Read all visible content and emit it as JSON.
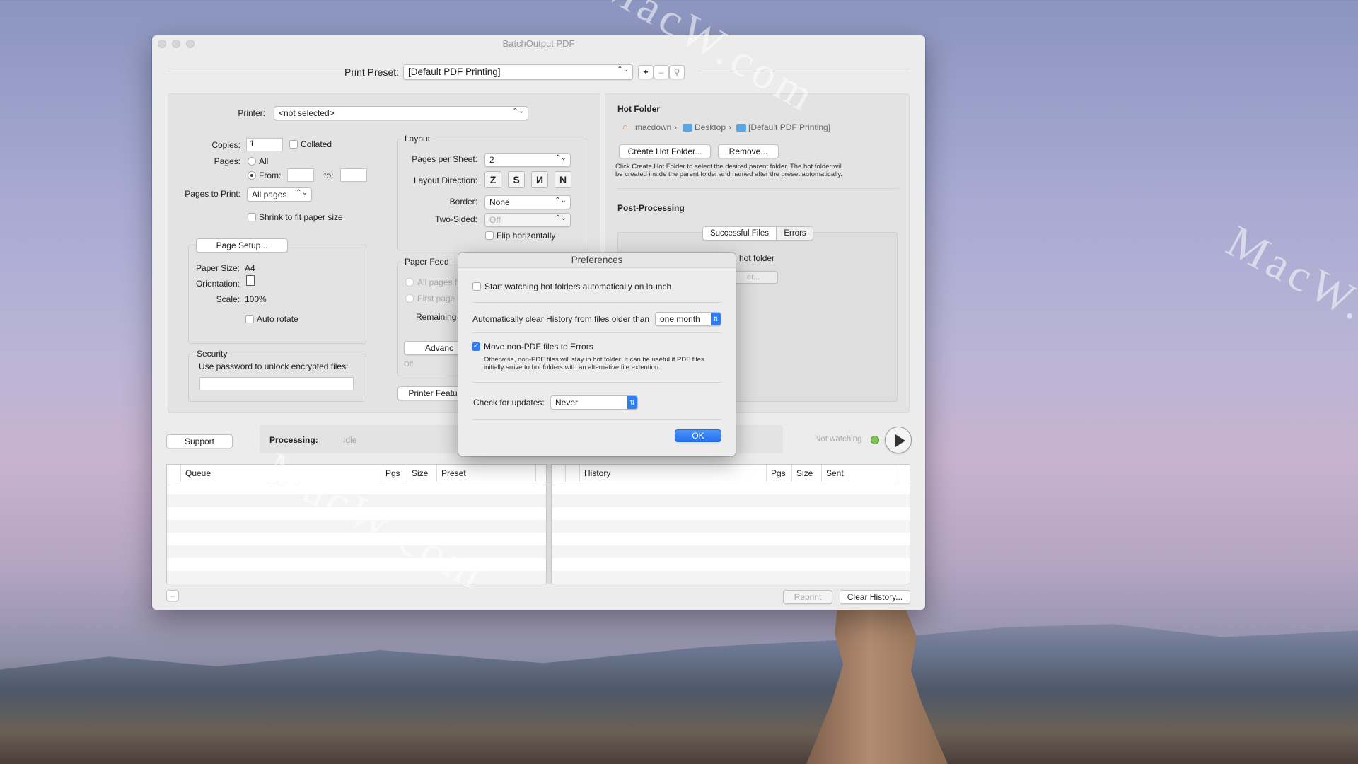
{
  "window": {
    "title": "BatchOutput PDF"
  },
  "preset": {
    "label": "Print Preset:",
    "value": "[Default PDF Printing]",
    "add": "+",
    "remove": "–",
    "tag": "⚲"
  },
  "printer": {
    "label": "Printer:",
    "value": "<not selected>"
  },
  "copies": {
    "label": "Copies:",
    "value": "1",
    "collated": "Collated"
  },
  "pages": {
    "label": "Pages:",
    "all": "All",
    "from": "From:",
    "to": "to:"
  },
  "pages_to_print": {
    "label": "Pages to Print:",
    "value": "All pages"
  },
  "shrink": "Shrink to fit paper size",
  "page_setup": {
    "button": "Page Setup...",
    "paper_size_label": "Paper Size:",
    "paper_size": "A4",
    "orientation_label": "Orientation:",
    "scale_label": "Scale:",
    "scale": "100%",
    "auto_rotate": "Auto rotate"
  },
  "security": {
    "title": "Security",
    "label": "Use password to unlock encrypted files:"
  },
  "layout": {
    "title": "Layout",
    "pps_label": "Pages per Sheet:",
    "pps": "2",
    "dir_label": "Layout Direction:",
    "dirs": [
      "Z",
      "S",
      "И",
      "N"
    ],
    "border_label": "Border:",
    "border": "None",
    "two_sided_label": "Two-Sided:",
    "two_sided": "Off",
    "flip": "Flip horizontally"
  },
  "paper_feed": {
    "title": "Paper Feed",
    "all_pages": "All pages fr",
    "first_page": "First page",
    "remaining": "Remaining",
    "advanced": "Advanc",
    "off": "Off"
  },
  "printer_features": "Printer Featu",
  "hot_folder": {
    "title": "Hot Folder",
    "path": [
      "macdown",
      "Desktop",
      "[Default PDF Printing]"
    ],
    "create": "Create Hot Folder...",
    "remove": "Remove...",
    "desc1": "Click Create Hot Folder to select the desired parent folder. The hot folder will",
    "desc2": "be created inside the parent folder and named after the preset automatically."
  },
  "post": {
    "title": "Post-Processing",
    "tabs": [
      "Successful Files",
      "Errors"
    ],
    "partial": "hot folder",
    "partial_btn": "er..."
  },
  "status": {
    "support": "Support",
    "processing_label": "Processing:",
    "processing": "Idle",
    "watching": "Not watching"
  },
  "queue": {
    "cols": [
      "Queue",
      "Pgs",
      "Size",
      "Preset"
    ]
  },
  "history": {
    "cols": [
      "History",
      "Pgs",
      "Size",
      "Sent"
    ]
  },
  "bottom": {
    "minus": "–",
    "reprint": "Reprint",
    "clear": "Clear History..."
  },
  "prefs": {
    "title": "Preferences",
    "watch": "Start watching hot folders automatically on launch",
    "clear_label": "Automatically clear History from files older than",
    "clear_value": "one month",
    "move": "Move non-PDF files to Errors",
    "move_desc1": "Otherwise, non-PDF files will stay in hot folder. It can be useful if PDF files",
    "move_desc2": "initially srrive to hot folders with an alternative file extention.",
    "updates_label": "Check for updates:",
    "updates_value": "Never",
    "ok": "OK"
  },
  "watermarks": [
    "MacW.com",
    "MacW.com",
    "MacW.com"
  ],
  "colors": {
    "accent": "#2f7df5",
    "status_dot": "#7fc454"
  }
}
